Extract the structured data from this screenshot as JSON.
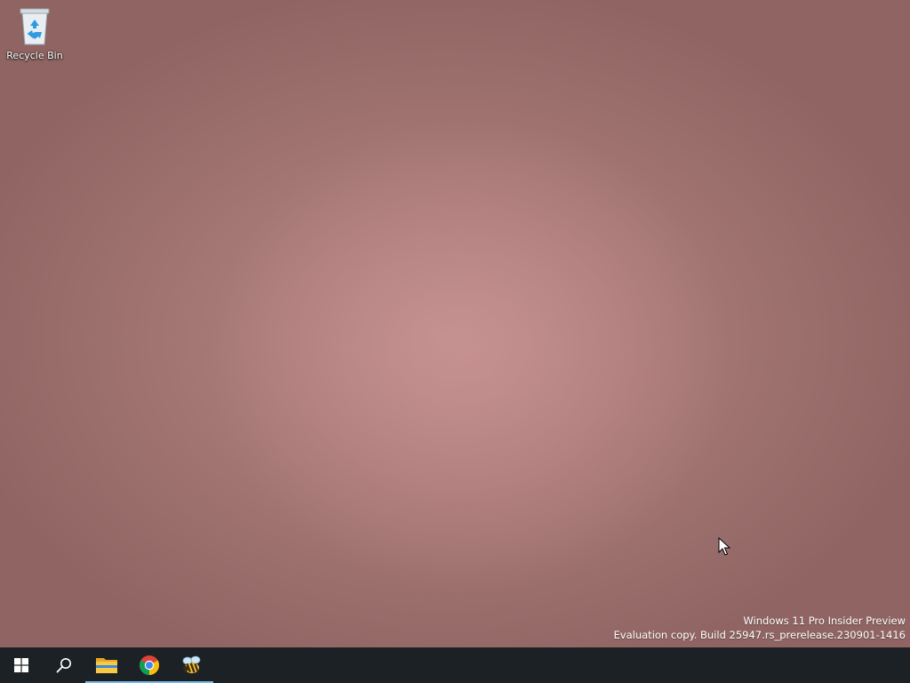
{
  "desktop": {
    "wallpaper": "close-up photograph (not reproduced)",
    "icons": [
      {
        "label": "Recycle Bin",
        "icon": "recycle-bin-icon"
      }
    ],
    "watermark": {
      "line1": "Windows 11 Pro Insider Preview",
      "line2": "Evaluation copy. Build 25947.rs_prerelease.230901-1416"
    }
  },
  "taskbar": {
    "background": "#1c2126",
    "running_indicator_color": "#76b9ed",
    "items": [
      {
        "name": "start",
        "icon": "windows-logo-icon",
        "running": false
      },
      {
        "name": "search",
        "icon": "search-icon",
        "running": false
      },
      {
        "name": "file-explorer",
        "icon": "folder-icon",
        "running": true
      },
      {
        "name": "chrome",
        "icon": "chrome-icon",
        "running": true
      },
      {
        "name": "app",
        "icon": "bee-app-icon",
        "running": true
      }
    ]
  }
}
